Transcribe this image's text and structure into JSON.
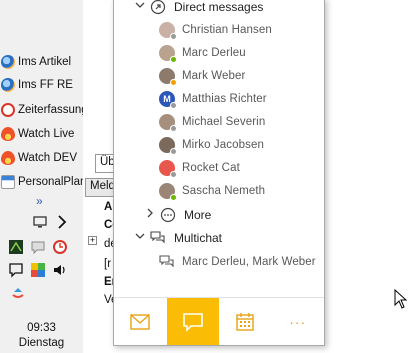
{
  "taskbar": {
    "items": [
      {
        "label": "Ims Artikel",
        "icon": "app-globe-icon"
      },
      {
        "label": "Ims FF RE",
        "icon": "app-globe-icon"
      },
      {
        "label": "Zeiterfassung",
        "icon": "clock-icon"
      },
      {
        "label": "Watch Live",
        "icon": "flame-icon"
      },
      {
        "label": "Watch DEV",
        "icon": "flame-icon"
      },
      {
        "label": "PersonalPlan",
        "icon": "calendar-app-icon"
      }
    ],
    "expand_glyph": "»",
    "clock": {
      "time": "09:33",
      "day": "Dienstag"
    }
  },
  "background_window": {
    "tooltip_top": "Üb",
    "tooltip_bottom": "Meld",
    "lines": [
      "Al",
      "Co",
      "de",
      "[r",
      "Er",
      "Ve"
    ],
    "expander": "+"
  },
  "popup": {
    "direct_messages": {
      "label": "Direct messages",
      "contacts": [
        {
          "name": "Christian Hansen",
          "presence": "#9a9a9a",
          "avatar": "#c9b2a5"
        },
        {
          "name": "Marc Derleu",
          "presence": "#6bb700",
          "avatar": "#b9a38f"
        },
        {
          "name": "Mark Weber",
          "presence": "#f2a000",
          "avatar": "#8d7a6a"
        },
        {
          "name": "Matthias Richter",
          "presence": "#9a9a9a",
          "avatar": "#2b57b8",
          "initial": "M"
        },
        {
          "name": "Michael Severin",
          "presence": "#9a9a9a",
          "avatar": "#a78f7e"
        },
        {
          "name": "Mirko Jacobsen",
          "presence": "#9a9a9a",
          "avatar": "#7b6a5c"
        },
        {
          "name": "Rocket Cat",
          "presence": "#9a9a9a",
          "avatar": "#e8574b"
        },
        {
          "name": "Sascha Nemeth",
          "presence": "#6bb700",
          "avatar": "#9b8676"
        }
      ]
    },
    "more": {
      "label": "More"
    },
    "multichat": {
      "label": "Multichat",
      "items": [
        {
          "name": "Marc Derleu, Mark Weber"
        }
      ]
    },
    "nav": [
      {
        "name": "mail-icon",
        "active": false
      },
      {
        "name": "chat-icon",
        "active": true
      },
      {
        "name": "calendar-icon",
        "active": false
      },
      {
        "name": "more-icon",
        "active": false,
        "glyph": "···"
      }
    ]
  },
  "colors": {
    "accent": "#fbbc05",
    "icon_orange": "#e8a317"
  }
}
